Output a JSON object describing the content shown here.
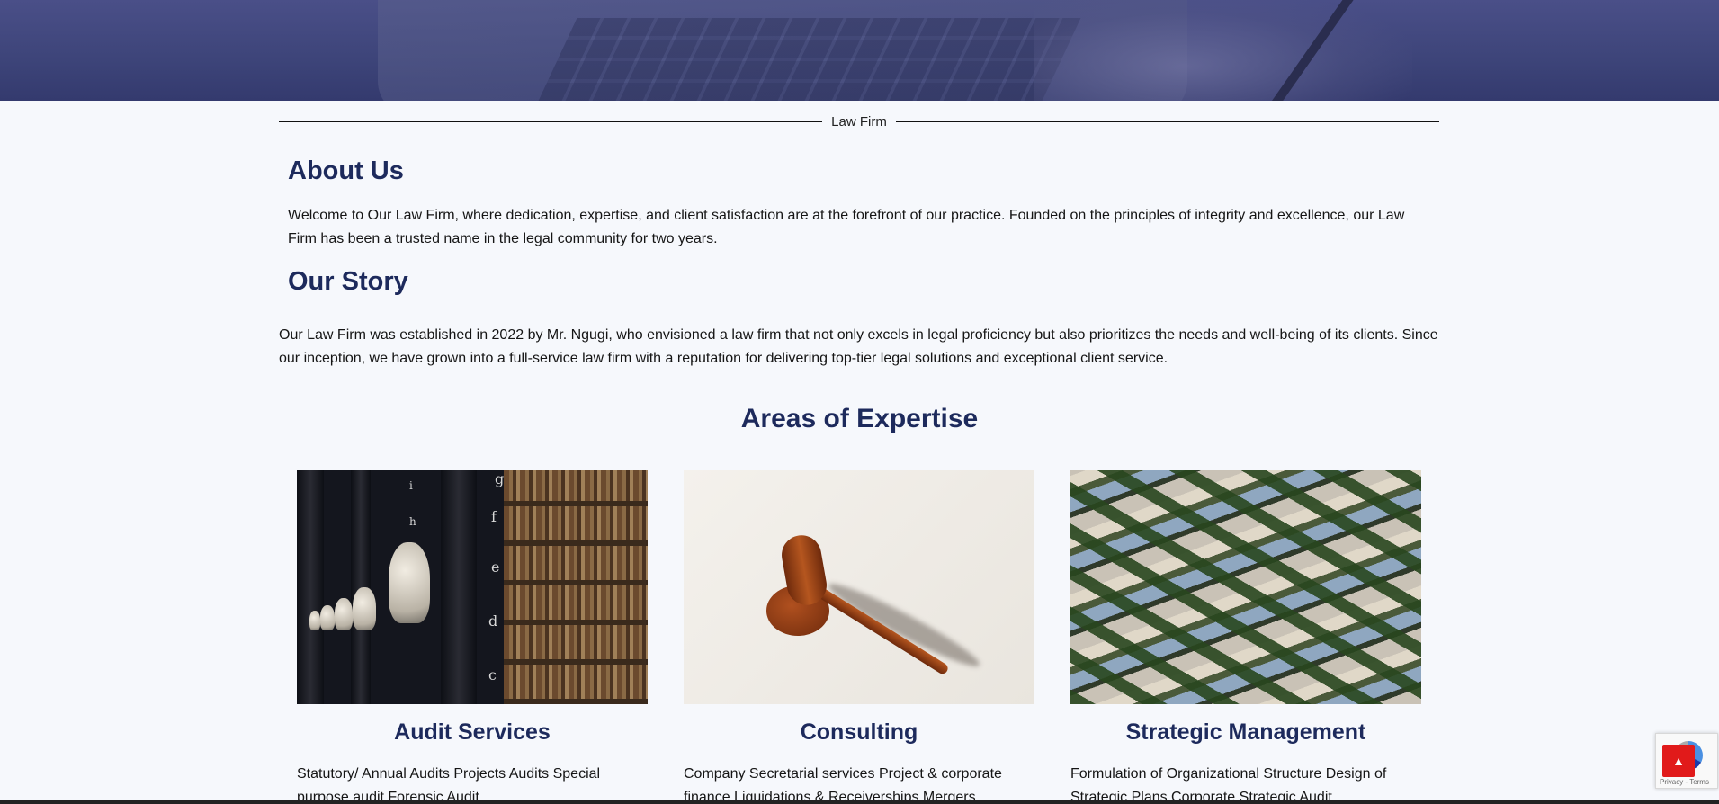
{
  "divider": {
    "label": "Law Firm"
  },
  "about": {
    "heading": "About Us",
    "text": "Welcome to Our Law Firm, where dedication, expertise, and client satisfaction are at the forefront of our practice. Founded on the principles of integrity and excellence, our Law Firm has been a trusted name in the legal community for two years."
  },
  "story": {
    "heading": "Our Story",
    "text": "Our Law Firm was established in 2022 by Mr. Ngugi, who envisioned a law firm that not only excels in legal proficiency but also prioritizes the needs and well-being of its clients. Since our inception, we have grown into a full-service law firm with a reputation for delivering top-tier legal solutions and exceptional client service."
  },
  "expertise": {
    "heading": "Areas of Expertise",
    "cards": [
      {
        "title": "Audit Services",
        "text": " Statutory/ Annual Audits Projects Audits Special purpose audit Forensic Audit"
      },
      {
        "title": "Consulting",
        "text": "Company Secretarial services Project & corporate finance Liquidations & Receiverships Mergers"
      },
      {
        "title": "Strategic Management",
        "text": "Formulation of Organizational Structure Design of Strategic Plans Corporate Strategic Audit"
      }
    ]
  },
  "recaptcha": {
    "terms": "Privacy - Terms"
  },
  "icons": {
    "scroll_top": "arrow-up-icon",
    "recaptcha": "recaptcha-icon"
  }
}
